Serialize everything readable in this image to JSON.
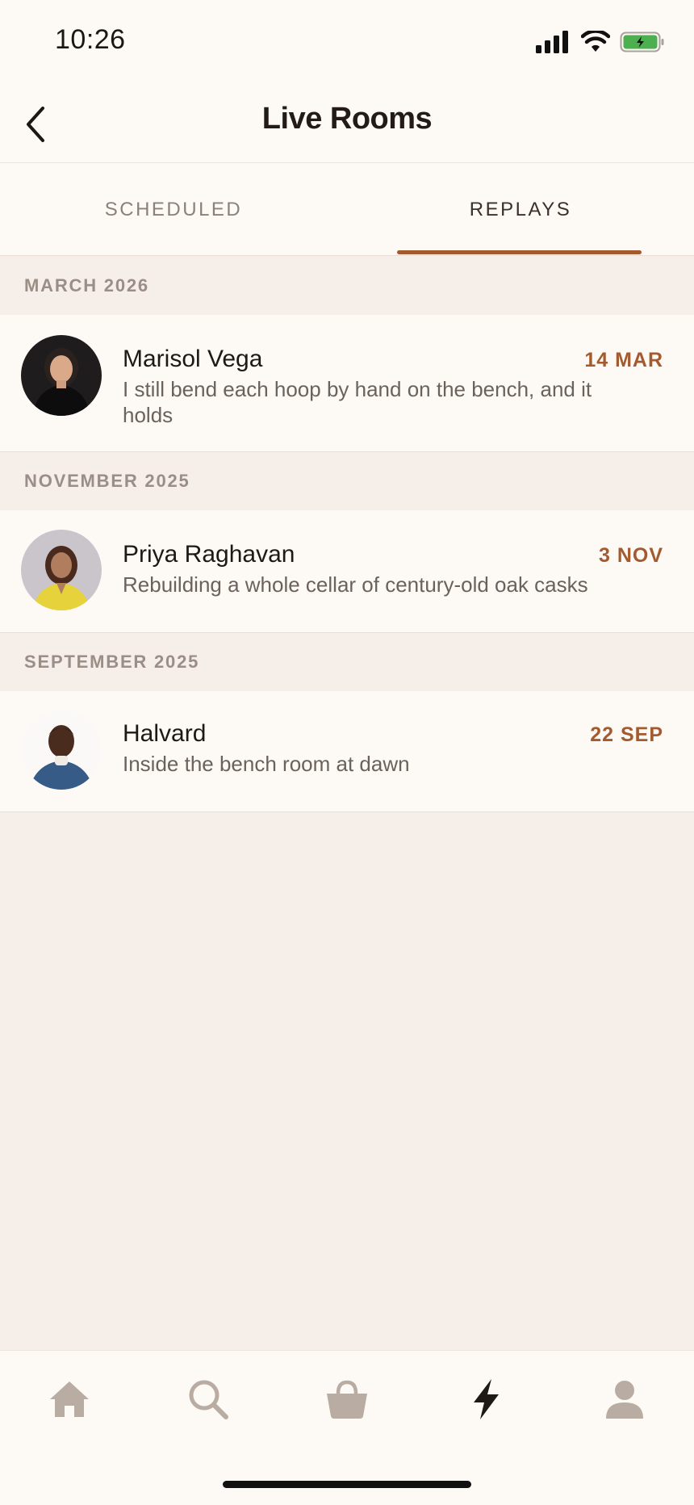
{
  "status_bar": {
    "time": "10:26"
  },
  "nav": {
    "title": "Live Rooms"
  },
  "tabs": [
    {
      "label": "SCHEDULED",
      "active": false
    },
    {
      "label": "REPLAYS",
      "active": true
    }
  ],
  "sections": [
    {
      "header": "MARCH 2026",
      "rooms": [
        {
          "host": "Marisol Vega",
          "date": "14 MAR",
          "title": "I still bend each hoop by hand on the bench, and it holds"
        }
      ]
    },
    {
      "header": "NOVEMBER 2025",
      "rooms": [
        {
          "host": "Priya Raghavan",
          "date": "3 NOV",
          "title": "Rebuilding a whole cellar of century-old oak casks"
        }
      ]
    },
    {
      "header": "SEPTEMBER 2025",
      "rooms": [
        {
          "host": "Halvard",
          "date": "22 SEP",
          "title": "Inside the bench room at dawn"
        }
      ]
    }
  ],
  "tab_bar": {
    "items": [
      "home-icon",
      "search-icon",
      "shopping-bag-icon",
      "lightning-icon",
      "profile-icon"
    ],
    "active": "lightning-icon"
  },
  "colors": {
    "accent": "#a45a2f",
    "background": "#f5eee9",
    "surface": "#fdf9f5",
    "battery": "#4caf50"
  }
}
